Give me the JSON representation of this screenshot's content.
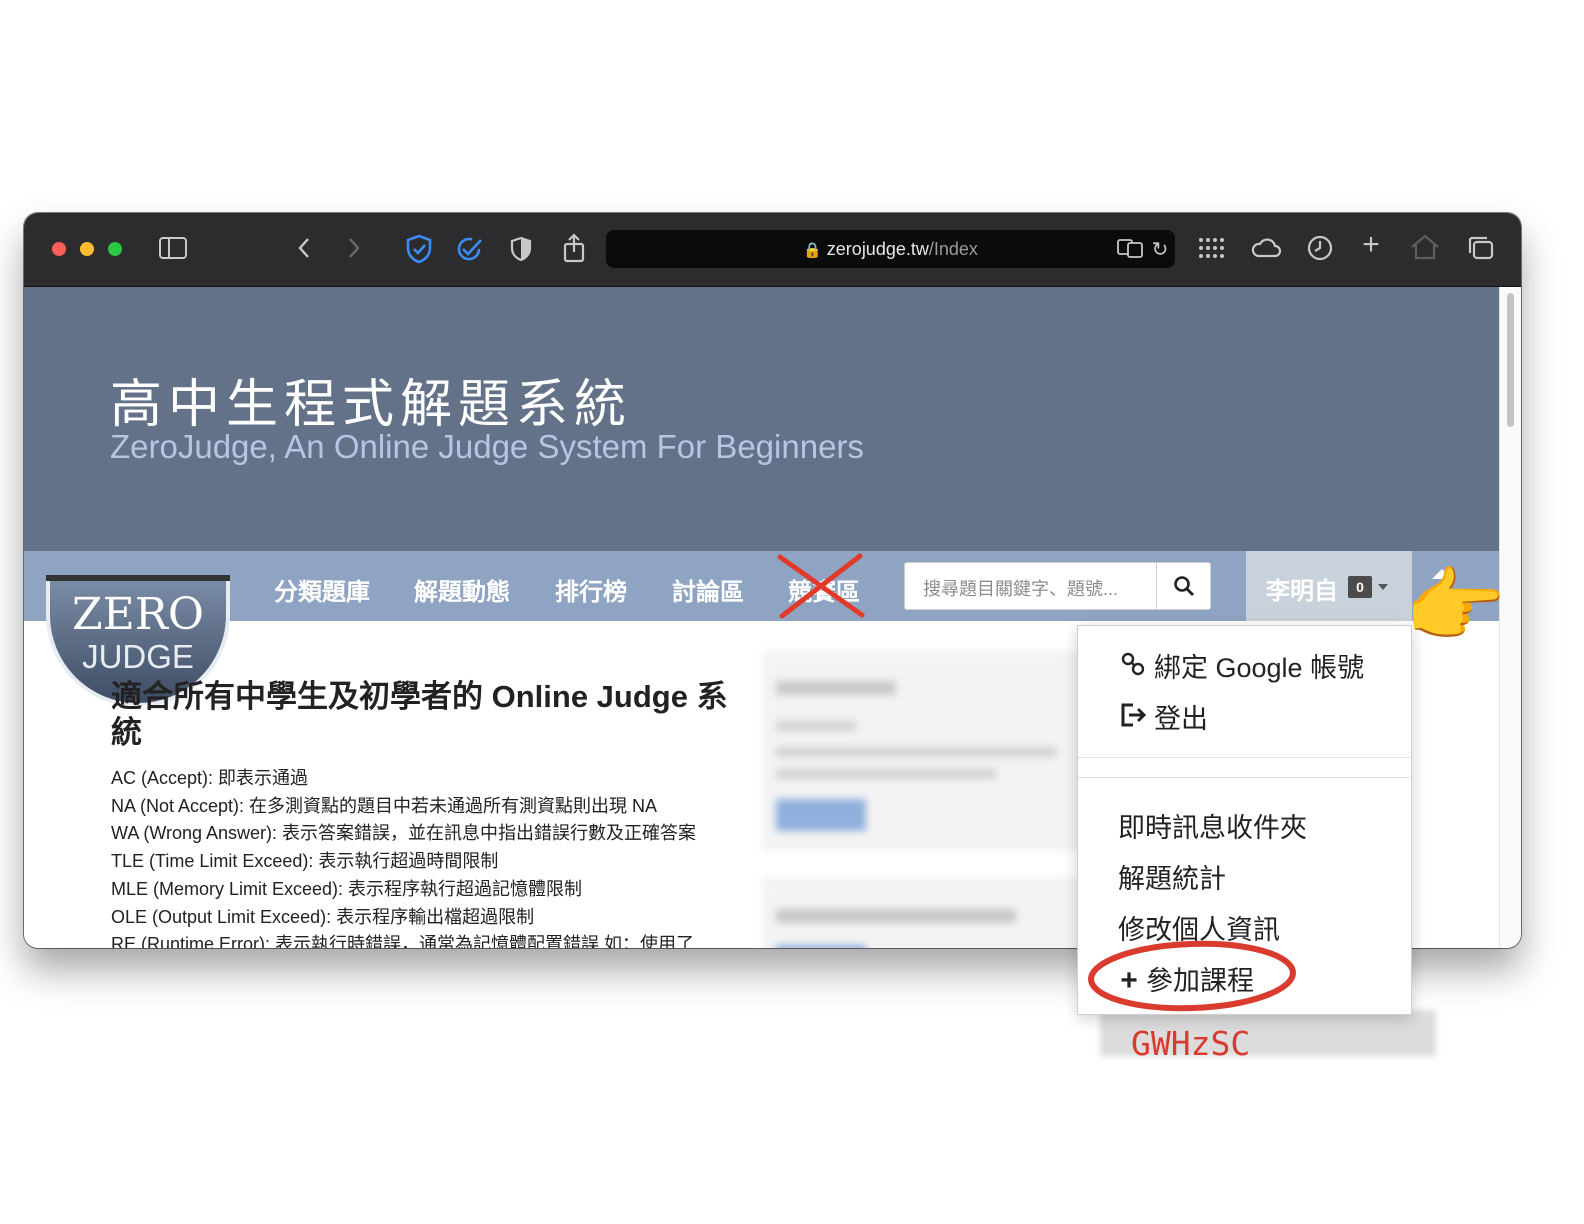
{
  "browser": {
    "url_host": "zerojudge.tw",
    "url_path": "/Index"
  },
  "site": {
    "title": "高中生程式解題系統",
    "subtitle": "ZeroJudge, An Online Judge System For Beginners",
    "logo_line1": "ZERO",
    "logo_line2": "JUDGE"
  },
  "nav": {
    "items": [
      "分類題庫",
      "解題動態",
      "排行榜",
      "討論區",
      "競賽區"
    ],
    "search_placeholder": "搜尋題目關鍵字、題號...",
    "user_name": "李明自",
    "message_count": "0"
  },
  "main": {
    "title": "適合所有中學生及初學者的 Online Judge 系統",
    "lines": [
      "AC (Accept): 即表示通過",
      "NA (Not Accept): 在多測資點的題目中若未通過所有測資點則出現 NA",
      "WA (Wrong Answer): 表示答案錯誤，並在訊息中指出錯誤行數及正確答案",
      "TLE (Time Limit Exceed): 表示執行超過時間限制",
      "MLE (Memory Limit Exceed): 表示程序執行超過記憶體限制",
      "OLE (Output Limit Exceed): 表示程序輸出檔超過限制",
      "RE (Runtime Error): 表示執行時錯誤，通常為記憶體配置錯誤 如：使用了"
    ]
  },
  "dropdown": {
    "items": [
      {
        "icon": "link-icon",
        "label": "綁定 Google 帳號"
      },
      {
        "icon": "logout-icon",
        "label": "登出"
      },
      {
        "icon": "",
        "label": "即時訊息收件夾"
      },
      {
        "icon": "",
        "label": "解題統計"
      },
      {
        "icon": "",
        "label": "修改個人資訊"
      },
      {
        "icon": "plus-icon",
        "label": "參加課程"
      }
    ]
  },
  "annotation": {
    "course_code": "GWHzSC",
    "highlight_color": "#d93b2f",
    "pointer_emoji": "👉"
  },
  "colors": {
    "banner": "#637189",
    "navbar": "#8fa4c2",
    "subtitle": "#b3c6e3"
  }
}
